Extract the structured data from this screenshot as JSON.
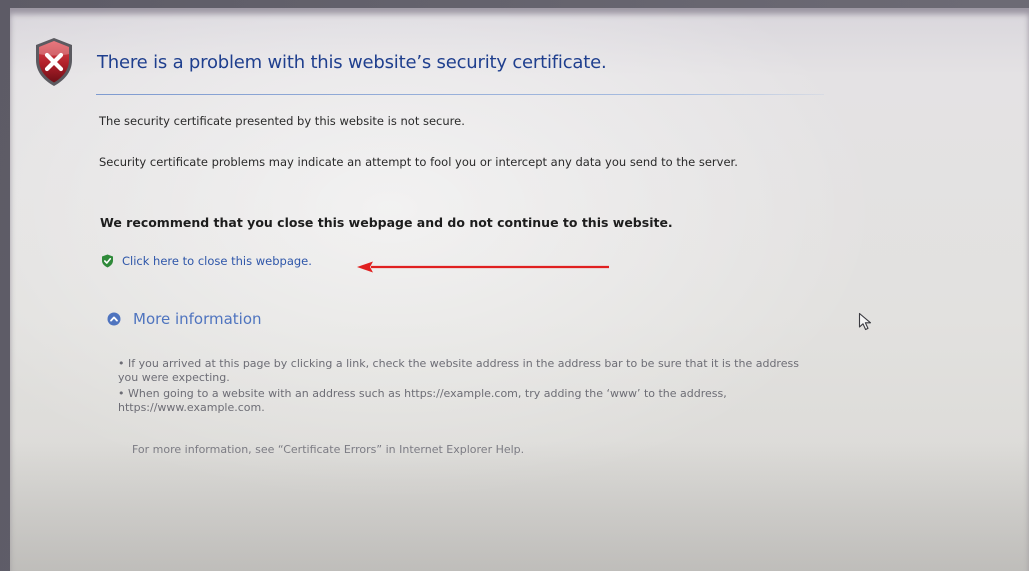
{
  "error_page": {
    "title": "There is a problem with this website’s security certificate.",
    "line1": "The security certificate presented by this website is not secure.",
    "line2": "Security certificate problems may indicate an attempt to fool you or intercept any data you send to the server.",
    "recommendation": "We recommend that you close this webpage and do not continue to this website.",
    "close_link": "Click here to close this webpage.",
    "more_info": {
      "label": "More information",
      "bullet1": "•  If you arrived at this page by clicking a link, check the website address in the address bar to be sure that it is the address you were expecting.",
      "bullet2": "•  When going to a website with an address such as https://example.com, try adding the ‘www’ to the address, https://www.example.com.",
      "help_text": "For more information, see “Certificate Errors” in Internet Explorer Help."
    }
  },
  "colors": {
    "title": "#1f3f8e",
    "link": "#2e56a9",
    "more_info": "#4f74bf",
    "annotation_arrow": "#e02020",
    "error_shield": "#b0202a",
    "safe_shield": "#2f8a3a"
  },
  "icons": {
    "error": "red-shield-x-icon",
    "close_link": "green-shield-check-icon",
    "more_info_toggle": "chevron-up-circle-icon",
    "pointer": "mouse-cursor-icon"
  }
}
